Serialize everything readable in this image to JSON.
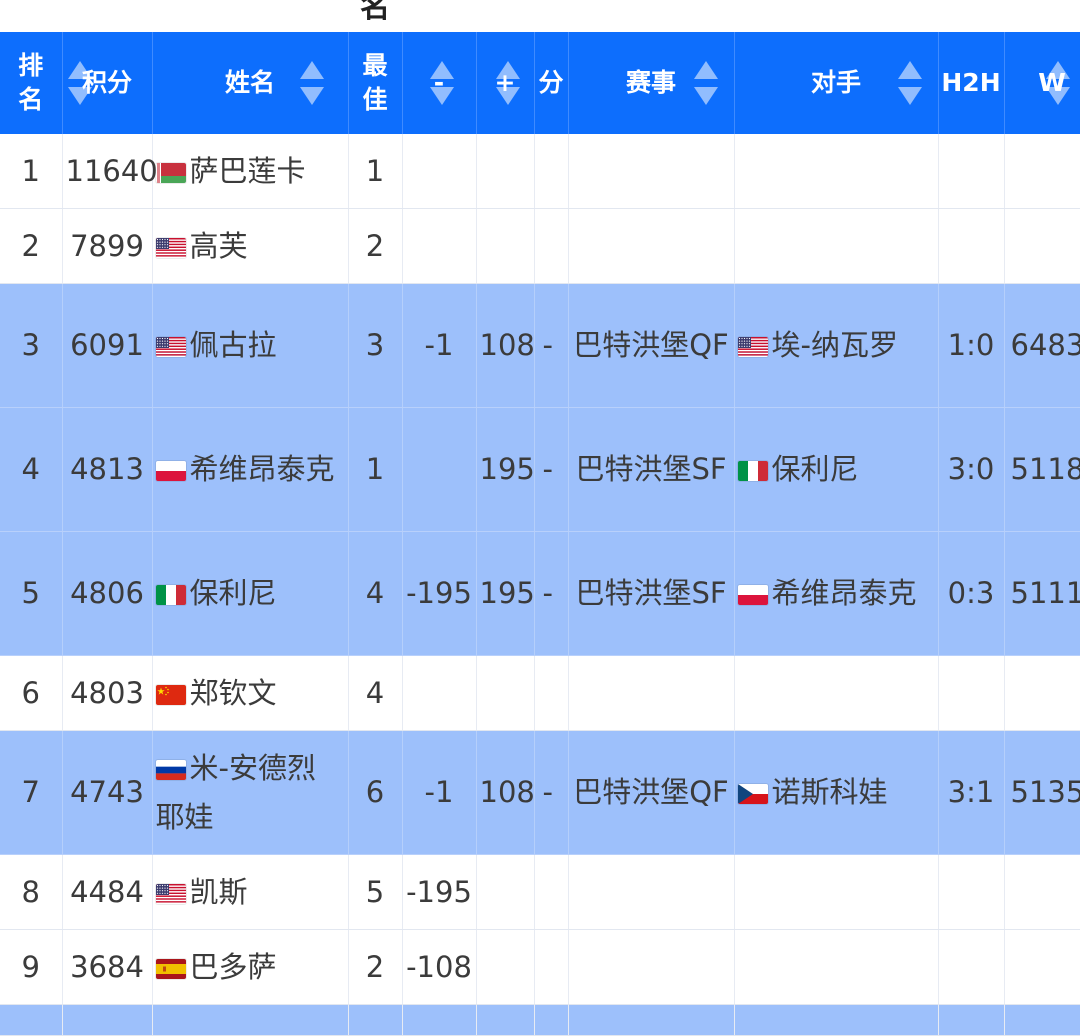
{
  "page": {
    "cut_title": "名"
  },
  "colors": {
    "header_bg": "#0d6efd",
    "highlight_row": "#9dc0fb"
  },
  "headers": [
    {
      "key": "rank",
      "label": "排名",
      "sortable": false
    },
    {
      "key": "points",
      "label": "积分",
      "sortable": true
    },
    {
      "key": "name",
      "label": "姓名",
      "sortable": true
    },
    {
      "key": "best",
      "label": "最佳",
      "sortable": false
    },
    {
      "key": "minus",
      "label": "-",
      "sortable": true
    },
    {
      "key": "plus",
      "label": "+",
      "sortable": true
    },
    {
      "key": "fen",
      "label": "分",
      "sortable": false
    },
    {
      "key": "event",
      "label": "赛事",
      "sortable": true
    },
    {
      "key": "opponent",
      "label": "对手",
      "sortable": true
    },
    {
      "key": "h2h",
      "label": "H2H",
      "sortable": false
    },
    {
      "key": "w",
      "label": "W",
      "sortable": true
    }
  ],
  "rows": [
    {
      "rank": "1",
      "points": "11640",
      "flag": "blr-flag-icon",
      "name": "萨巴莲卡",
      "best": "1",
      "minus": "",
      "plus": "",
      "fen": "",
      "event": "",
      "opp_flag": "",
      "opponent": "",
      "h2h": "",
      "w": "",
      "highlight": false
    },
    {
      "rank": "2",
      "points": "7899",
      "flag": "usa-flag-icon",
      "name": "高芙",
      "best": "2",
      "minus": "",
      "plus": "",
      "fen": "",
      "event": "",
      "opp_flag": "",
      "opponent": "",
      "h2h": "",
      "w": "",
      "highlight": false
    },
    {
      "rank": "3",
      "points": "6091",
      "flag": "usa-flag-icon",
      "name": "佩古拉",
      "best": "3",
      "minus": "-1",
      "plus": "108",
      "fen": "-",
      "event": "巴特洪堡QF",
      "opp_flag": "usa-flag-icon",
      "opponent": "埃-纳瓦罗",
      "h2h": "1:0",
      "w": "6483",
      "highlight": true
    },
    {
      "rank": "4",
      "points": "4813",
      "flag": "pol-flag-icon",
      "name": "希维昂泰克",
      "best": "1",
      "minus": "",
      "plus": "195",
      "fen": "-",
      "event": "巴特洪堡SF",
      "opp_flag": "ita-flag-icon",
      "opponent": "保利尼",
      "h2h": "3:0",
      "w": "5118",
      "highlight": true
    },
    {
      "rank": "5",
      "points": "4806",
      "flag": "ita-flag-icon",
      "name": "保利尼",
      "best": "4",
      "minus": "-195",
      "plus": "195",
      "fen": "-",
      "event": "巴特洪堡SF",
      "opp_flag": "pol-flag-icon",
      "opponent": "希维昂泰克",
      "h2h": "0:3",
      "w": "5111",
      "highlight": true
    },
    {
      "rank": "6",
      "points": "4803",
      "flag": "chn-flag-icon",
      "name": "郑钦文",
      "best": "4",
      "minus": "",
      "plus": "",
      "fen": "",
      "event": "",
      "opp_flag": "",
      "opponent": "",
      "h2h": "",
      "w": "",
      "highlight": false
    },
    {
      "rank": "7",
      "points": "4743",
      "flag": "rus-flag-icon",
      "name": "米-安德烈耶娃",
      "best": "6",
      "minus": "-1",
      "plus": "108",
      "fen": "-",
      "event": "巴特洪堡QF",
      "opp_flag": "cze-flag-icon",
      "opponent": "诺斯科娃",
      "h2h": "3:1",
      "w": "5135",
      "highlight": true
    },
    {
      "rank": "8",
      "points": "4484",
      "flag": "usa-flag-icon",
      "name": "凯斯",
      "best": "5",
      "minus": "-195",
      "plus": "",
      "fen": "",
      "event": "",
      "opp_flag": "",
      "opponent": "",
      "h2h": "",
      "w": "",
      "highlight": false
    },
    {
      "rank": "9",
      "points": "3684",
      "flag": "esp-flag-icon",
      "name": "巴多萨",
      "best": "2",
      "minus": "-108",
      "plus": "",
      "fen": "",
      "event": "",
      "opp_flag": "",
      "opponent": "",
      "h2h": "",
      "w": "",
      "highlight": false
    }
  ]
}
